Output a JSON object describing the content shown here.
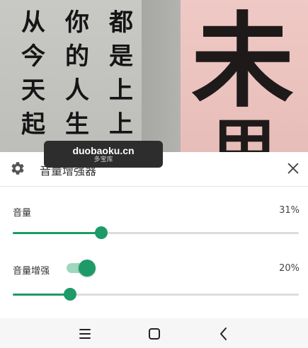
{
  "wallpaper": {
    "poem_chars": [
      "从",
      "你",
      "都",
      "今",
      "的",
      "是",
      "天",
      "人",
      "上",
      "起",
      "生",
      "上"
    ],
    "big_char": "未",
    "big_char_2": "甲"
  },
  "panel": {
    "title": "音量增强器",
    "gear_icon": "gear-icon",
    "close_icon": "close-icon",
    "volume": {
      "label": "音量",
      "value_text": "31%",
      "value": 0.31
    },
    "boost": {
      "label": "音量增强",
      "enabled": true,
      "value_text": "20%",
      "value": 0.2
    },
    "accent_color": "#1e9a68"
  },
  "watermark": {
    "line1": "duobaoku.cn",
    "line2": "多宝库"
  },
  "navbar": {
    "menu_icon": "menu-icon",
    "home_icon": "home-icon",
    "back_icon": "back-icon"
  }
}
